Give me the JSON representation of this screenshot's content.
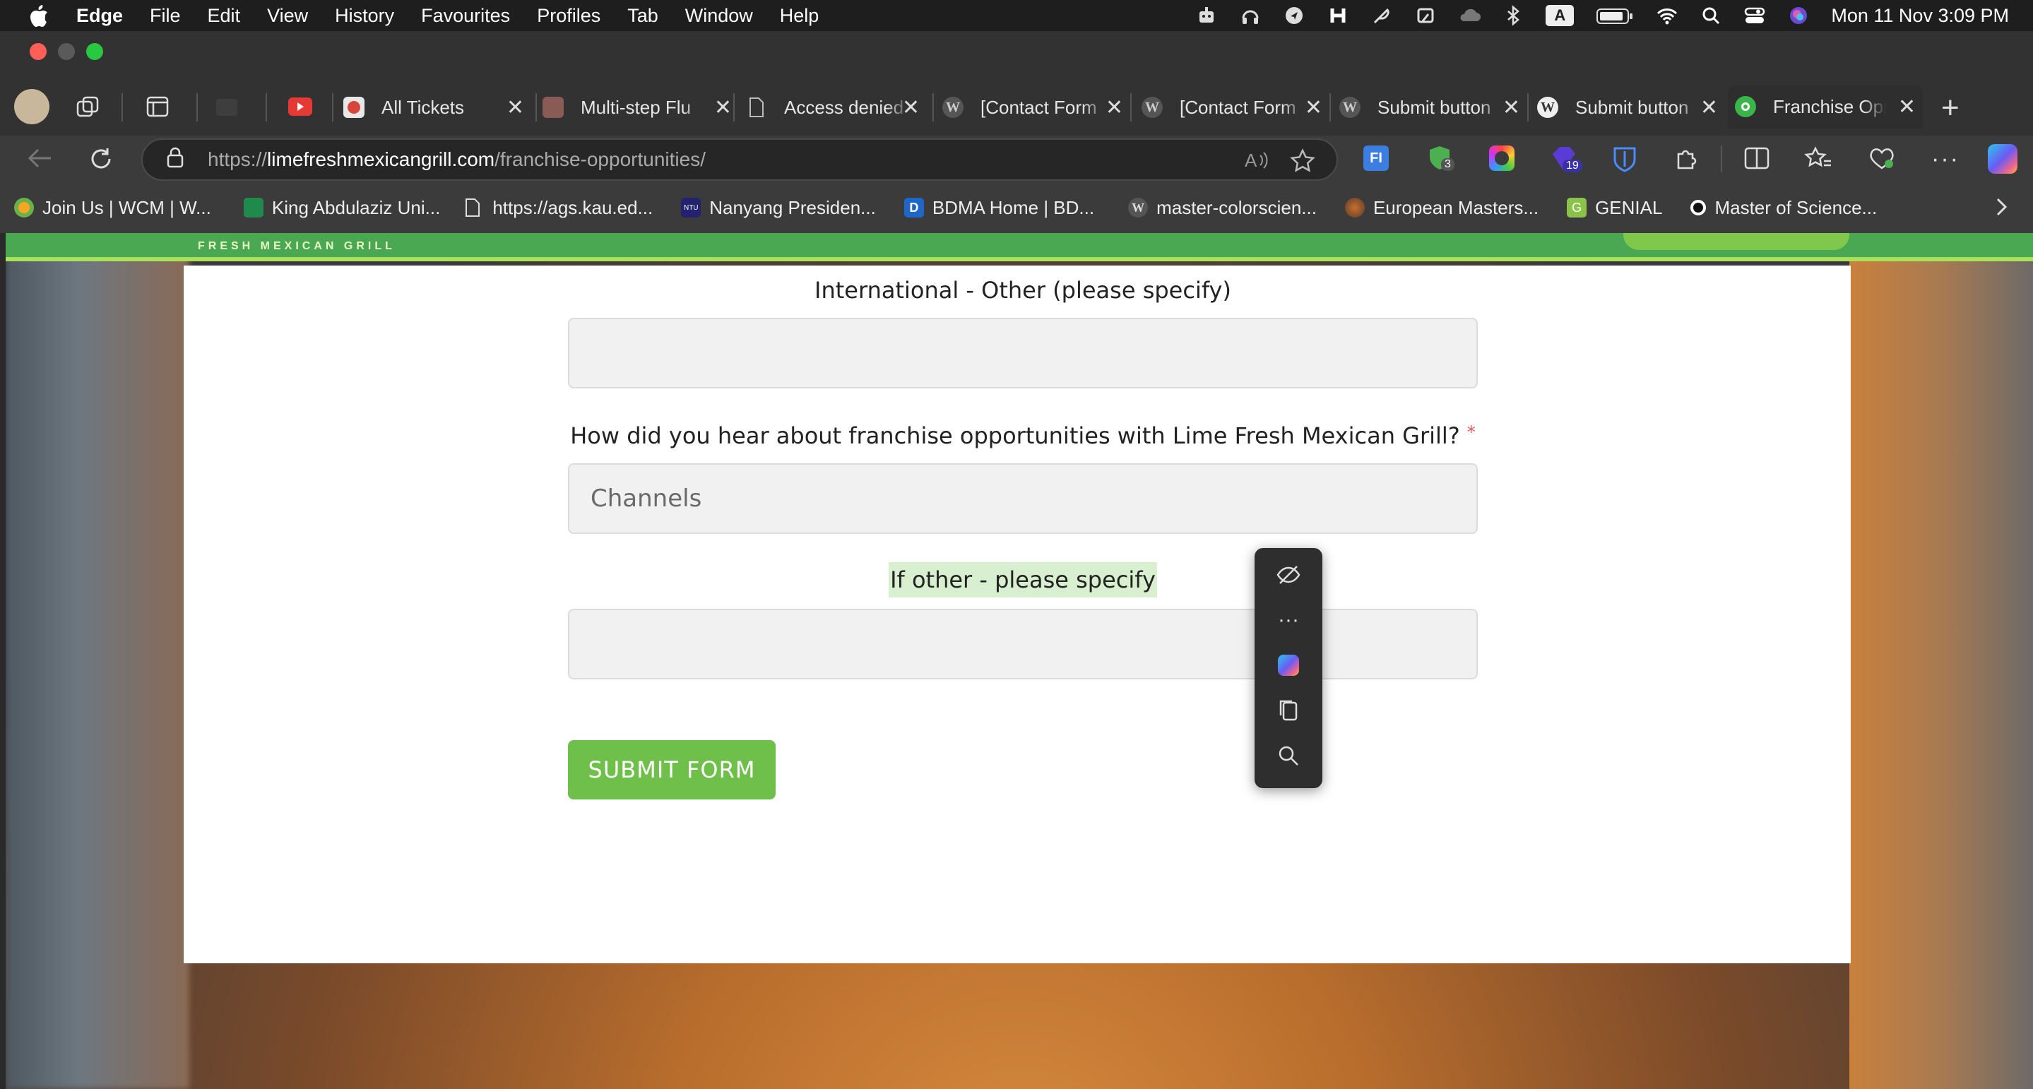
{
  "menubar": {
    "app": "Edge",
    "items": [
      "File",
      "Edit",
      "View",
      "History",
      "Favourites",
      "Profiles",
      "Tab",
      "Window",
      "Help"
    ],
    "clock": "Mon 11 Nov  3:09 PM",
    "input_indicator": "A"
  },
  "tabs": [
    {
      "label": "All Tickets"
    },
    {
      "label": "Multi-step Flu"
    },
    {
      "label": "Access denied"
    },
    {
      "label": "[Contact Form"
    },
    {
      "label": "[Contact Form"
    },
    {
      "label": "Submit button"
    },
    {
      "label": "Submit button"
    },
    {
      "label": "Franchise Opp"
    }
  ],
  "address": {
    "scheme": "https://",
    "host": "limefreshmexicangrill.com",
    "path": "/franchise-opportunities/"
  },
  "extension_badges": {
    "shield_count": "3",
    "ext_count": "19"
  },
  "bookmarks": [
    "Join Us | WCM | W...",
    "King Abdulaziz Uni...",
    "https://ags.kau.ed...",
    "Nanyang Presiden...",
    "BDMA Home | BD...",
    "master-colorscien...",
    "European Masters...",
    "GENIAL",
    "Master of Science..."
  ],
  "site": {
    "logo_text": "FRESH MEXICAN GRILL"
  },
  "form": {
    "intl_label": "International - Other (please specify)",
    "intl_value": "",
    "hear_label": "How did you hear about franchise opportunities with Lime Fresh Mexican Grill?",
    "required_mark": "*",
    "hear_placeholder": "Channels",
    "other_label": "If other - please specify",
    "other_value": "",
    "submit_label": "SUBMIT FORM"
  },
  "colors": {
    "brand_green": "#4aa852",
    "submit_green": "#6fbf4b",
    "highlight": "#d8f0d0"
  }
}
